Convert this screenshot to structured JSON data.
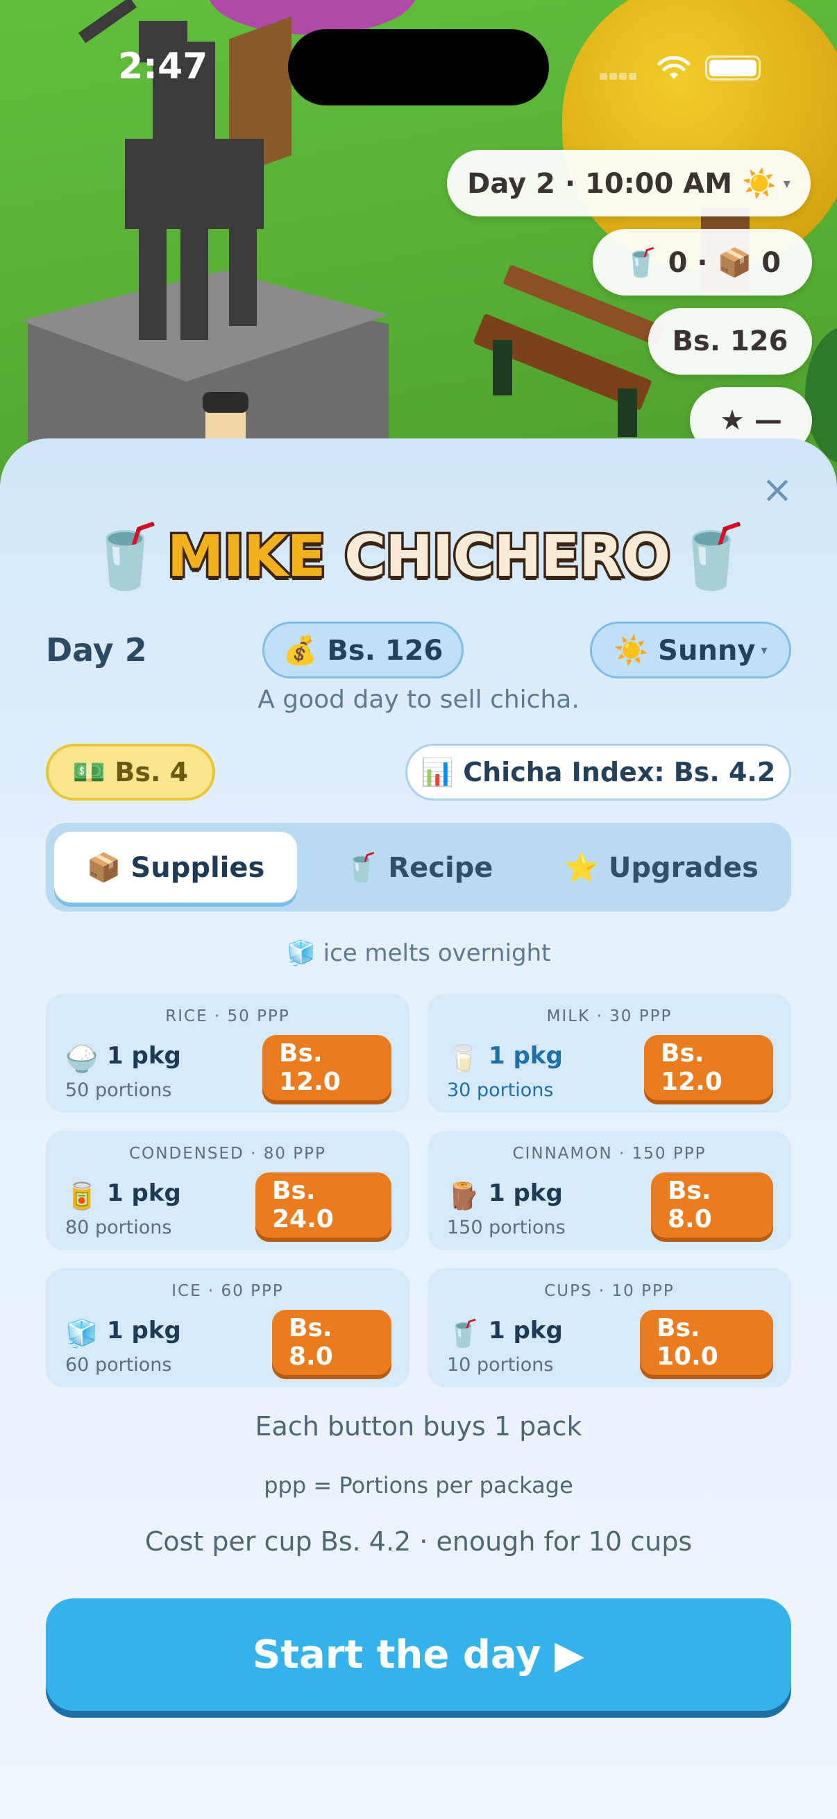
{
  "status_bar": {
    "time": "2:47"
  },
  "hud": {
    "day_time": "Day 2 · 10:00 AM ☀️",
    "stock": "🥤 0 · 📦 0",
    "money": "Bs. 126",
    "rating": "★ —"
  },
  "sheet": {
    "logo": {
      "cup": "🥤",
      "word1": "MIKE",
      "word2": "CHICHERO"
    },
    "day": "Day 2",
    "money": "💰 Bs. 126",
    "weather": "☀️ Sunny",
    "tagline": "A good day to sell chicha.",
    "cash": "💵 Bs. 4",
    "index": "📊 Chicha Index: Bs. 4.2",
    "tabs": [
      {
        "label": "📦 Supplies"
      },
      {
        "label": "🥤 Recipe"
      },
      {
        "label": "⭐ Upgrades"
      }
    ],
    "note": "🧊 ice melts overnight",
    "supplies": [
      {
        "title": "RICE · 50 PPP",
        "emoji": "🍚",
        "qty": "1 pkg",
        "portions": "50 portions",
        "price": "Bs. 12.0"
      },
      {
        "title": "MILK · 30 PPP",
        "emoji": "🥛",
        "qty": "1 pkg",
        "portions": "30 portions",
        "price": "Bs. 12.0"
      },
      {
        "title": "CONDENSED · 80 PPP",
        "emoji": "🥫",
        "qty": "1 pkg",
        "portions": "80 portions",
        "price": "Bs. 24.0"
      },
      {
        "title": "CINNAMON · 150 PPP",
        "emoji": "🪵",
        "qty": "1 pkg",
        "portions": "150 portions",
        "price": "Bs. 8.0"
      },
      {
        "title": "ICE · 60 PPP",
        "emoji": "🧊",
        "qty": "1 pkg",
        "portions": "60 portions",
        "price": "Bs. 8.0"
      },
      {
        "title": "CUPS · 10 PPP",
        "emoji": "🥤",
        "qty": "1 pkg",
        "portions": "10 portions",
        "price": "Bs. 10.0"
      }
    ],
    "info_buy": "Each button buys 1 pack",
    "info_ppp": "ppp = Portions per package",
    "info_cost": "Cost per cup Bs. 4.2 · enough for 10 cups",
    "start_label": "Start the day ▶"
  }
}
